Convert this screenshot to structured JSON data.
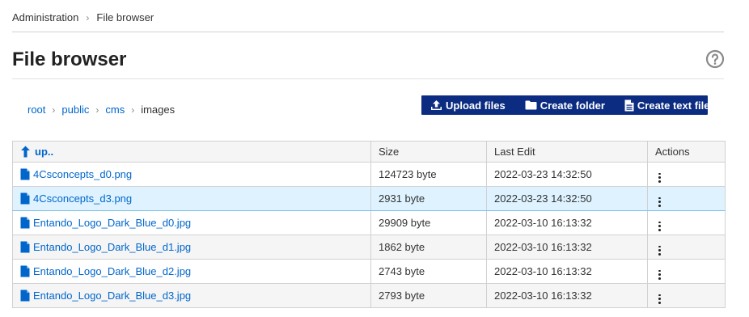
{
  "breadcrumb": {
    "items": [
      "Administration",
      "File browser"
    ]
  },
  "page": {
    "title": "File browser",
    "help_icon": "question-circle-icon"
  },
  "path": {
    "segments": [
      "root",
      "public",
      "cms"
    ],
    "current": "images"
  },
  "toolbar": {
    "upload_label": "Upload files",
    "create_folder_label": "Create folder",
    "create_text_file_label": "Create text file",
    "bg_color": "#0b2c80"
  },
  "table": {
    "headers": {
      "name": "up..",
      "size": "Size",
      "last_edit": "Last Edit",
      "actions": "Actions"
    },
    "rows": [
      {
        "name": "4Csconcepts_d0.png",
        "size": "124723 byte",
        "last_edit": "2022-03-23 14:32:50"
      },
      {
        "name": "4Csconcepts_d3.png",
        "size": "2931 byte",
        "last_edit": "2022-03-23 14:32:50"
      },
      {
        "name": "Entando_Logo_Dark_Blue_d0.jpg",
        "size": "29909 byte",
        "last_edit": "2022-03-10 16:13:32"
      },
      {
        "name": "Entando_Logo_Dark_Blue_d1.jpg",
        "size": "1862 byte",
        "last_edit": "2022-03-10 16:13:32"
      },
      {
        "name": "Entando_Logo_Dark_Blue_d2.jpg",
        "size": "2743 byte",
        "last_edit": "2022-03-10 16:13:32"
      },
      {
        "name": "Entando_Logo_Dark_Blue_d3.jpg",
        "size": "2793 byte",
        "last_edit": "2022-03-10 16:13:32"
      }
    ],
    "selected_row": 1
  }
}
